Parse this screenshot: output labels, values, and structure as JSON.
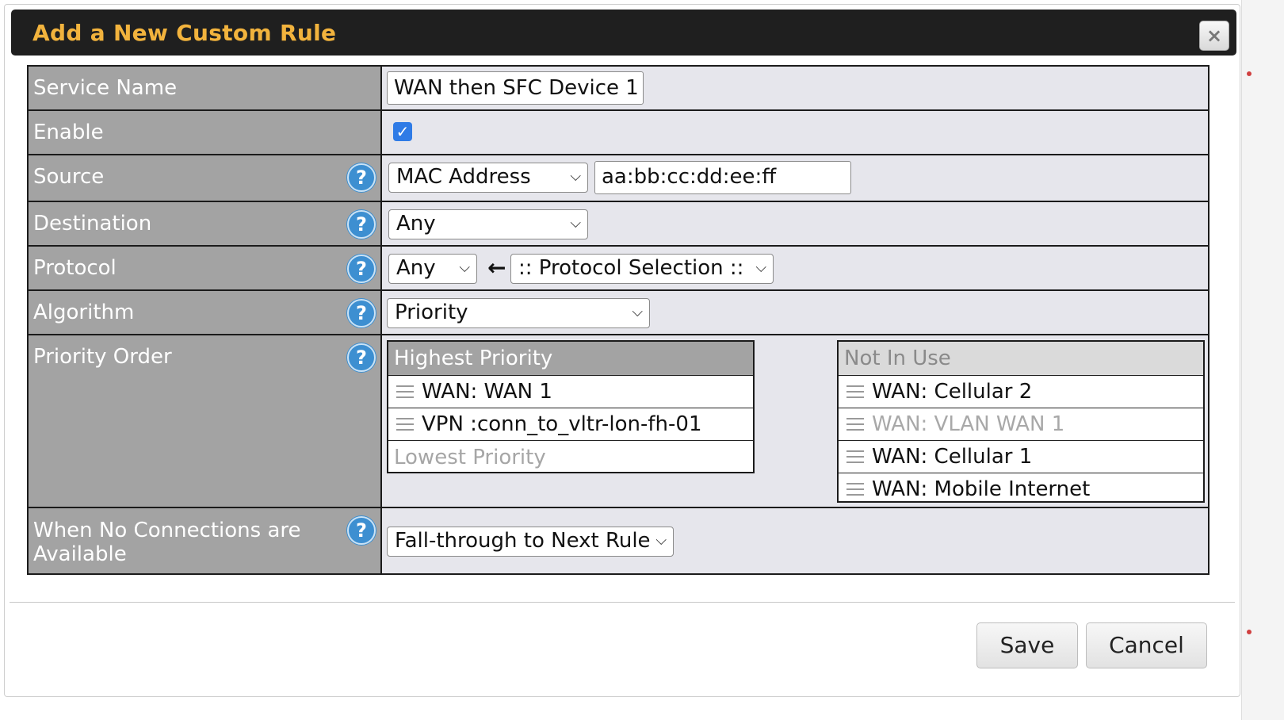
{
  "dialog": {
    "title": "Add a New Custom Rule",
    "close_icon": "×"
  },
  "form": {
    "service_name": {
      "label": "Service Name",
      "value": "WAN then SFC Device 1"
    },
    "enable": {
      "label": "Enable",
      "checked": true,
      "check_glyph": "✓"
    },
    "source": {
      "label": "Source",
      "type_selected": "MAC Address",
      "value": "aa:bb:cc:dd:ee:ff"
    },
    "destination": {
      "label": "Destination",
      "selected": "Any"
    },
    "protocol": {
      "label": "Protocol",
      "selected": "Any",
      "arrow": "←",
      "protocol_selection": ":: Protocol Selection ::"
    },
    "algorithm": {
      "label": "Algorithm",
      "selected": "Priority"
    },
    "priority_order": {
      "label": "Priority Order",
      "in_use": {
        "header": "Highest Priority",
        "items": [
          "WAN: WAN 1",
          "VPN :conn_to_vltr-lon-fh-01"
        ],
        "footer": "Lowest Priority"
      },
      "not_in_use": {
        "header": "Not In Use",
        "items": [
          {
            "label": "WAN: Cellular 2",
            "muted": false
          },
          {
            "label": "WAN: VLAN WAN 1",
            "muted": true
          },
          {
            "label": "WAN: Cellular 1",
            "muted": false
          },
          {
            "label": "WAN: Mobile Internet",
            "muted": false
          }
        ]
      }
    },
    "no_connections": {
      "label_line1": "When No Connections are",
      "label_line2": "Available",
      "selected": "Fall-through to Next Rule"
    }
  },
  "help_glyph": "?",
  "chevron_glyph": "⌵",
  "buttons": {
    "save": "Save",
    "cancel": "Cancel"
  },
  "colors": {
    "title": "#f2b33d",
    "label_bg": "#a3a3a3",
    "value_bg": "#e6e6ec",
    "help": "#3d8fd1",
    "checkbox": "#2f7be6"
  }
}
